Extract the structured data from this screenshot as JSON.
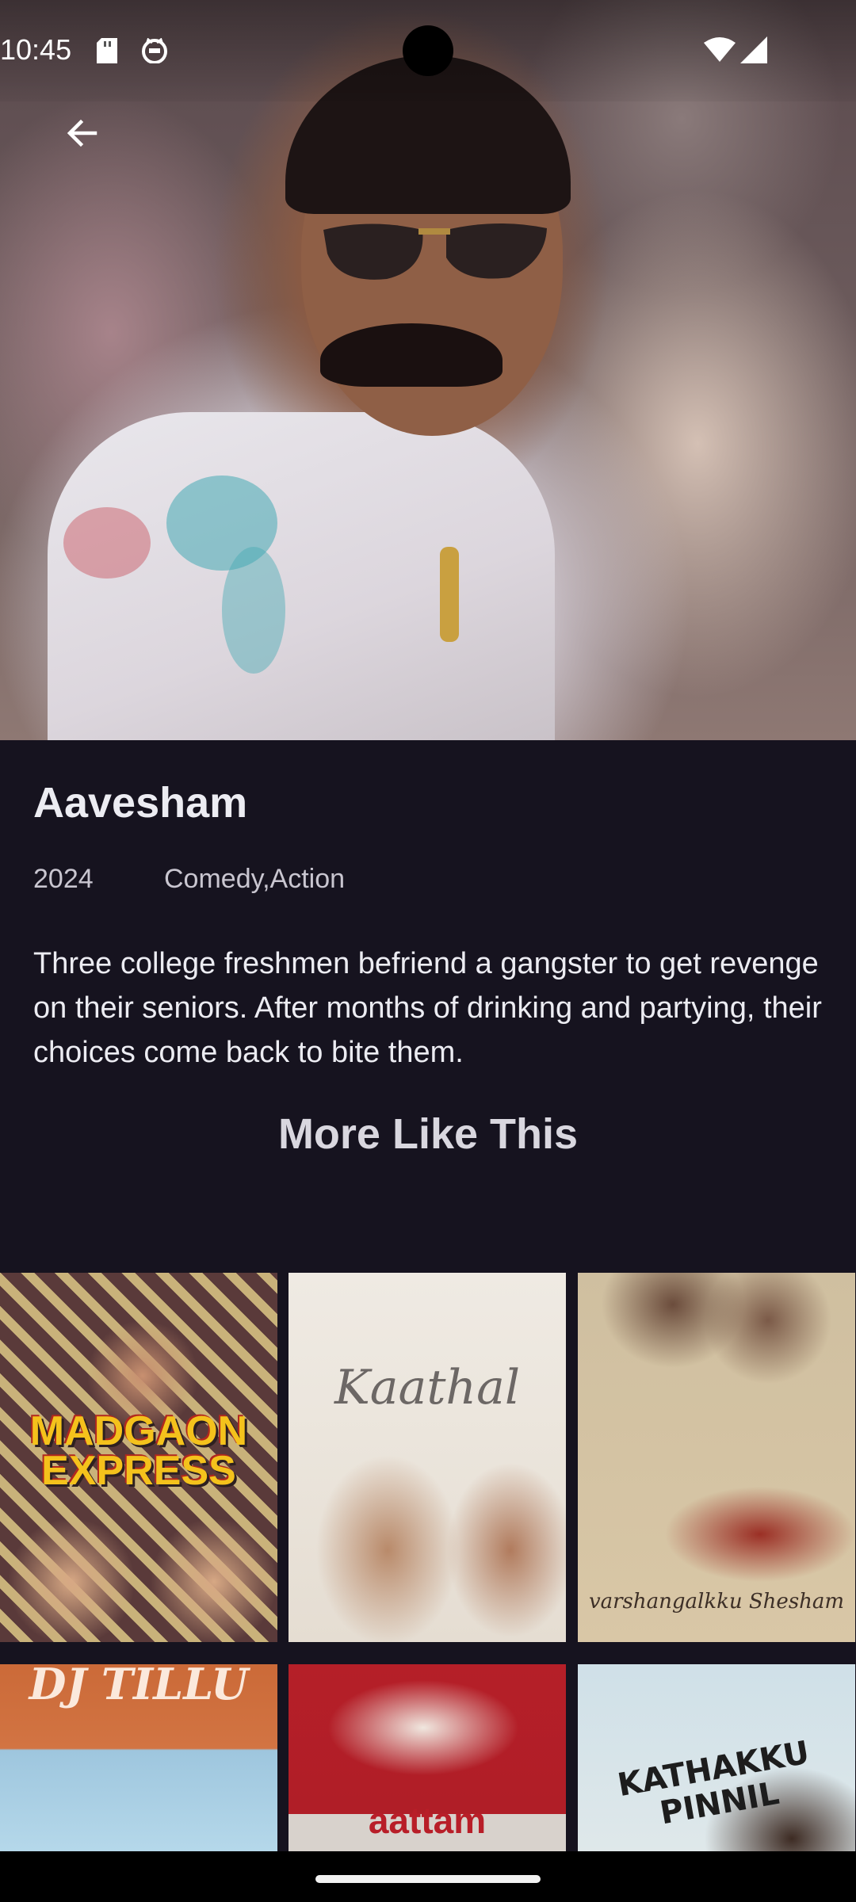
{
  "status_bar": {
    "time": "10:45",
    "icons": [
      "sd-card-icon",
      "cat-face-icon",
      "wifi-icon",
      "cell-signal-icon"
    ]
  },
  "header": {
    "back_icon": "back-arrow-icon"
  },
  "movie": {
    "title": "Aavesham",
    "year": "2024",
    "genres": "Comedy,Action",
    "description": "Three college freshmen befriend a gangster to get revenge on their seniors. After months of drinking and partying, their choices come back to bite them."
  },
  "more_like_this": {
    "title": "More Like This",
    "posters": [
      {
        "title": "MADGAON EXPRESS"
      },
      {
        "title": "Kaathal"
      },
      {
        "title": "varshangalkku Shesham"
      },
      {
        "title": "DJ TILLU"
      },
      {
        "title": "aattam"
      },
      {
        "title": "KATHAKKU PINNIL"
      }
    ]
  },
  "colors": {
    "background": "#16131f",
    "text": "#ececf2",
    "muted_text": "#c9c6d0"
  }
}
